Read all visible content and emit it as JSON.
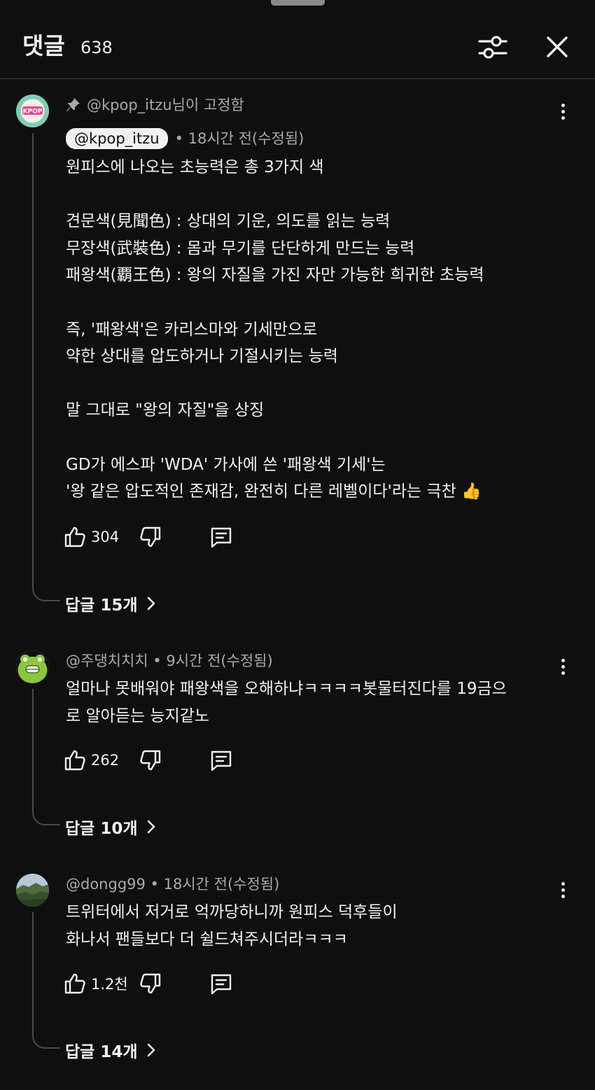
{
  "header": {
    "title": "댓글",
    "count": "638"
  },
  "comments": [
    {
      "pinned_label": "@kpop_itzu님이 고정함",
      "author": "@kpop_itzu",
      "time": "• 18시간 전(수정됨)",
      "avatar_text": "KPOP",
      "body": "원피스에 나오는 초능력은 총 3가지 색\n\n견문색(見聞色) : 상대의 기운, 의도를 읽는 능력\n무장색(武裝色) : 몸과 무기를 단단하게 만드는 능력\n패왕색(覇王色) : 왕의 자질을 가진 자만 가능한 희귀한 초능력\n\n즉, '패왕색'은 카리스마와 기세만으로\n약한 상대를 압도하거나 기절시키는 능력\n\n말 그대로 \"왕의 자질\"을 상징\n\nGD가 에스파 'WDA' 가사에 쓴 '패왕색 기세'는\n'왕 같은 압도적인 존재감, 완전히 다른 레벨이다'라는 극찬 👍",
      "likes": "304",
      "replies": "답글 15개"
    },
    {
      "author_line": "@주댕치치치 • 9시간 전(수정됨)",
      "body": "얼마나 못배워야 패왕색을 오해하냐ㅋㅋㅋㅋ봇물터진다를 19금으\n로 알아듣는 능지같노",
      "likes": "262",
      "replies": "답글 10개"
    },
    {
      "author_line": "@dongg99 • 18시간 전(수정됨)",
      "body": "트위터에서 저거로 억까당하니까 원피스 덕후들이\n화나서 팬들보다 더 쉴드쳐주시더라ㅋㅋㅋ",
      "likes": "1.2천",
      "replies": "답글 14개"
    }
  ],
  "icons": {
    "filter": "sliders-icon",
    "close": "close-icon",
    "pin": "pin-icon",
    "like": "thumbs-up-icon",
    "dislike": "thumbs-down-icon",
    "reply": "comment-icon",
    "more": "more-vert-icon",
    "chevron": "chevron-right-icon"
  },
  "colors": {
    "background": "#0f0f0f",
    "text": "#f1f1f1",
    "secondary_text": "#aaaaaa",
    "divider": "#3a3a3a"
  }
}
